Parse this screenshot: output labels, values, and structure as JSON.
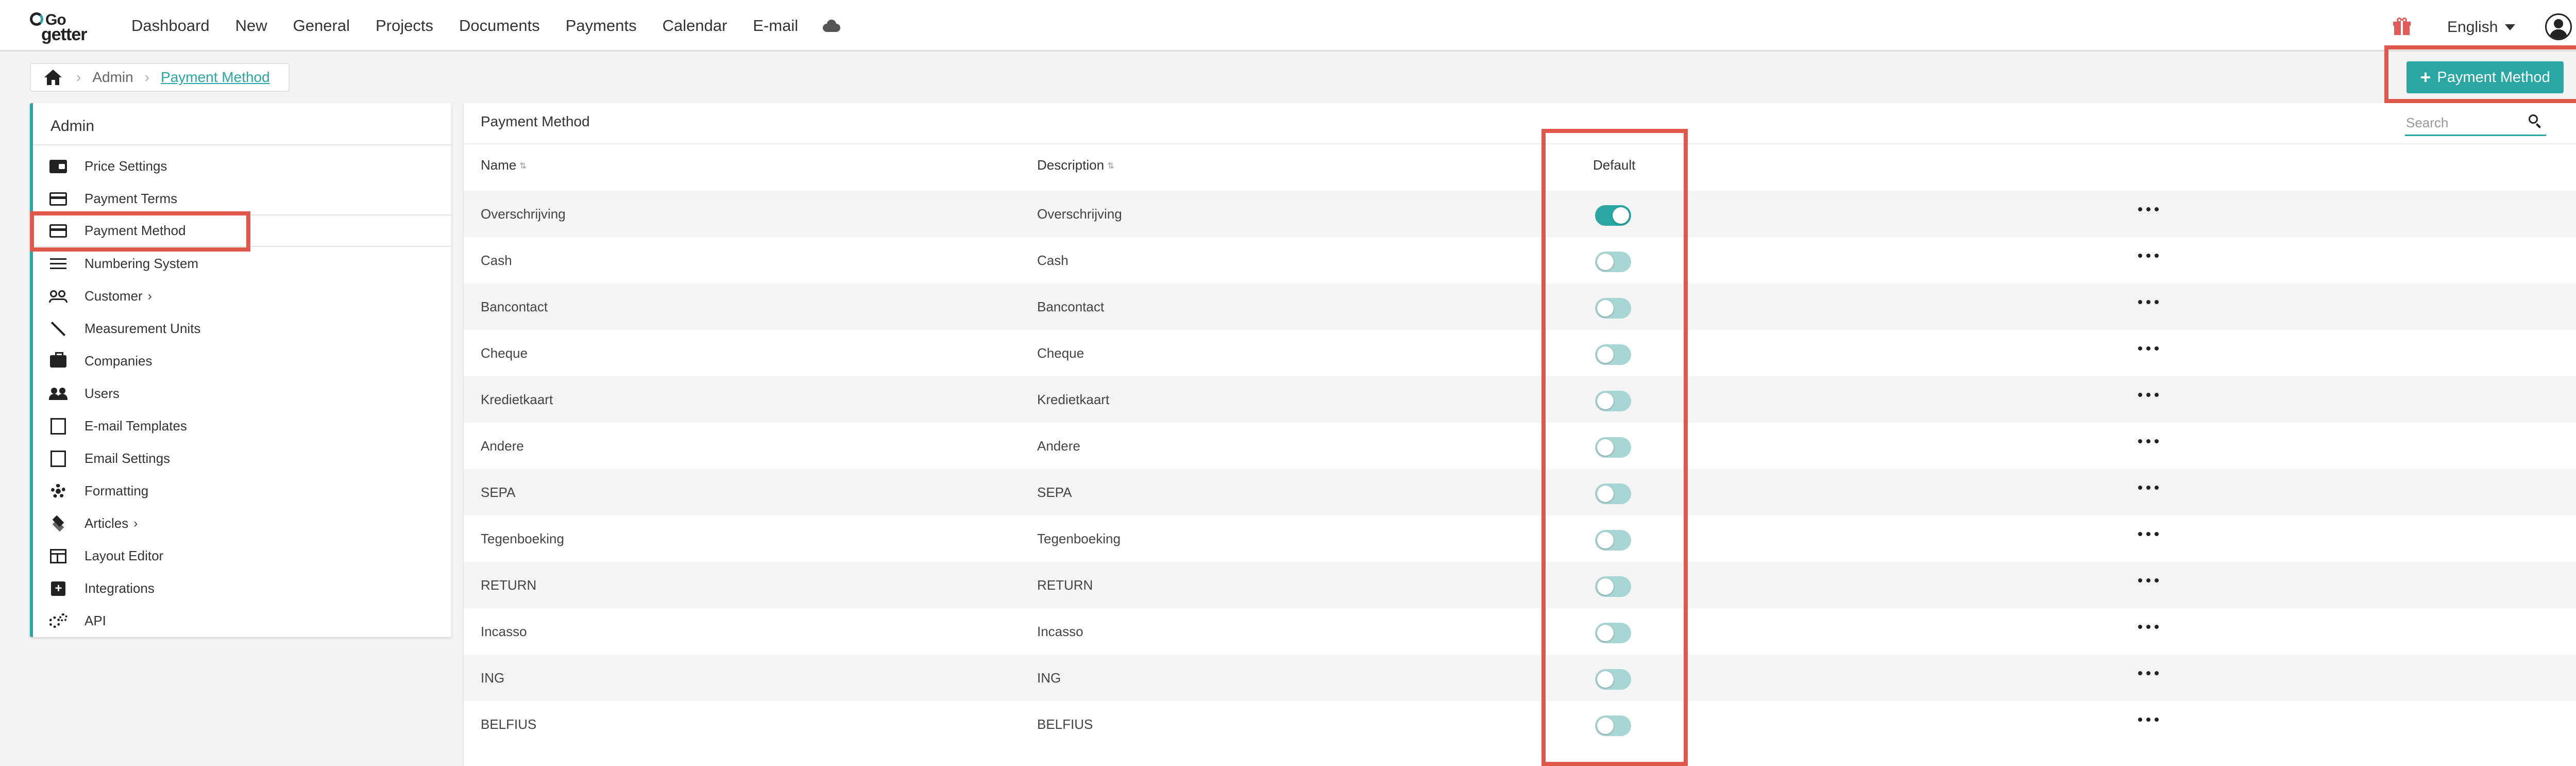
{
  "nav": {
    "logo_top": "Go",
    "logo_bottom": "getter",
    "items": [
      "Dashboard",
      "New",
      "General",
      "Projects",
      "Documents",
      "Payments",
      "Calendar",
      "E-mail"
    ],
    "language": "English"
  },
  "breadcrumb": {
    "items": [
      "Admin",
      "Payment Method"
    ]
  },
  "add_button": {
    "label": "Payment Method"
  },
  "sidebar": {
    "title": "Admin",
    "items": [
      {
        "label": "Price Settings",
        "icon": "wallet-icon"
      },
      {
        "label": "Payment Terms",
        "icon": "credit-card-icon"
      },
      {
        "label": "Payment Method",
        "icon": "credit-card-icon",
        "active": true
      },
      {
        "label": "Numbering System",
        "icon": "list-icon"
      },
      {
        "label": "Customer",
        "icon": "people-icon",
        "chevron": true
      },
      {
        "label": "Measurement Units",
        "icon": "resize-arrows-icon"
      },
      {
        "label": "Companies",
        "icon": "briefcase-icon"
      },
      {
        "label": "Users",
        "icon": "users-icon"
      },
      {
        "label": "E-mail Templates",
        "icon": "template-icon"
      },
      {
        "label": "Email Settings",
        "icon": "template-icon"
      },
      {
        "label": "Formatting",
        "icon": "gear-icon"
      },
      {
        "label": "Articles",
        "icon": "layers-icon",
        "chevron": true
      },
      {
        "label": "Layout Editor",
        "icon": "layout-icon"
      },
      {
        "label": "Integrations",
        "icon": "plus-box-icon"
      },
      {
        "label": "API",
        "icon": "gears-icon"
      }
    ]
  },
  "main": {
    "title": "Payment Method",
    "search_placeholder": "Search",
    "columns": {
      "name": "Name",
      "description": "Description",
      "default": "Default"
    },
    "rows": [
      {
        "name": "Overschrijving",
        "description": "Overschrijving",
        "default": true
      },
      {
        "name": "Cash",
        "description": "Cash",
        "default": false
      },
      {
        "name": "Bancontact",
        "description": "Bancontact",
        "default": false
      },
      {
        "name": "Cheque",
        "description": "Cheque",
        "default": false
      },
      {
        "name": "Kredietkaart",
        "description": "Kredietkaart",
        "default": false
      },
      {
        "name": "Andere",
        "description": "Andere",
        "default": false
      },
      {
        "name": "SEPA",
        "description": "SEPA",
        "default": false
      },
      {
        "name": "Tegenboeking",
        "description": "Tegenboeking",
        "default": false
      },
      {
        "name": "RETURN",
        "description": "RETURN",
        "default": false
      },
      {
        "name": "Incasso",
        "description": "Incasso",
        "default": false
      },
      {
        "name": "ING",
        "description": "ING",
        "default": false
      },
      {
        "name": "BELFIUS",
        "description": "BELFIUS",
        "default": false
      }
    ]
  },
  "colors": {
    "accent": "#2aa7a3",
    "toggle_off": "#a8d6d4",
    "highlight": "#e0574c"
  }
}
